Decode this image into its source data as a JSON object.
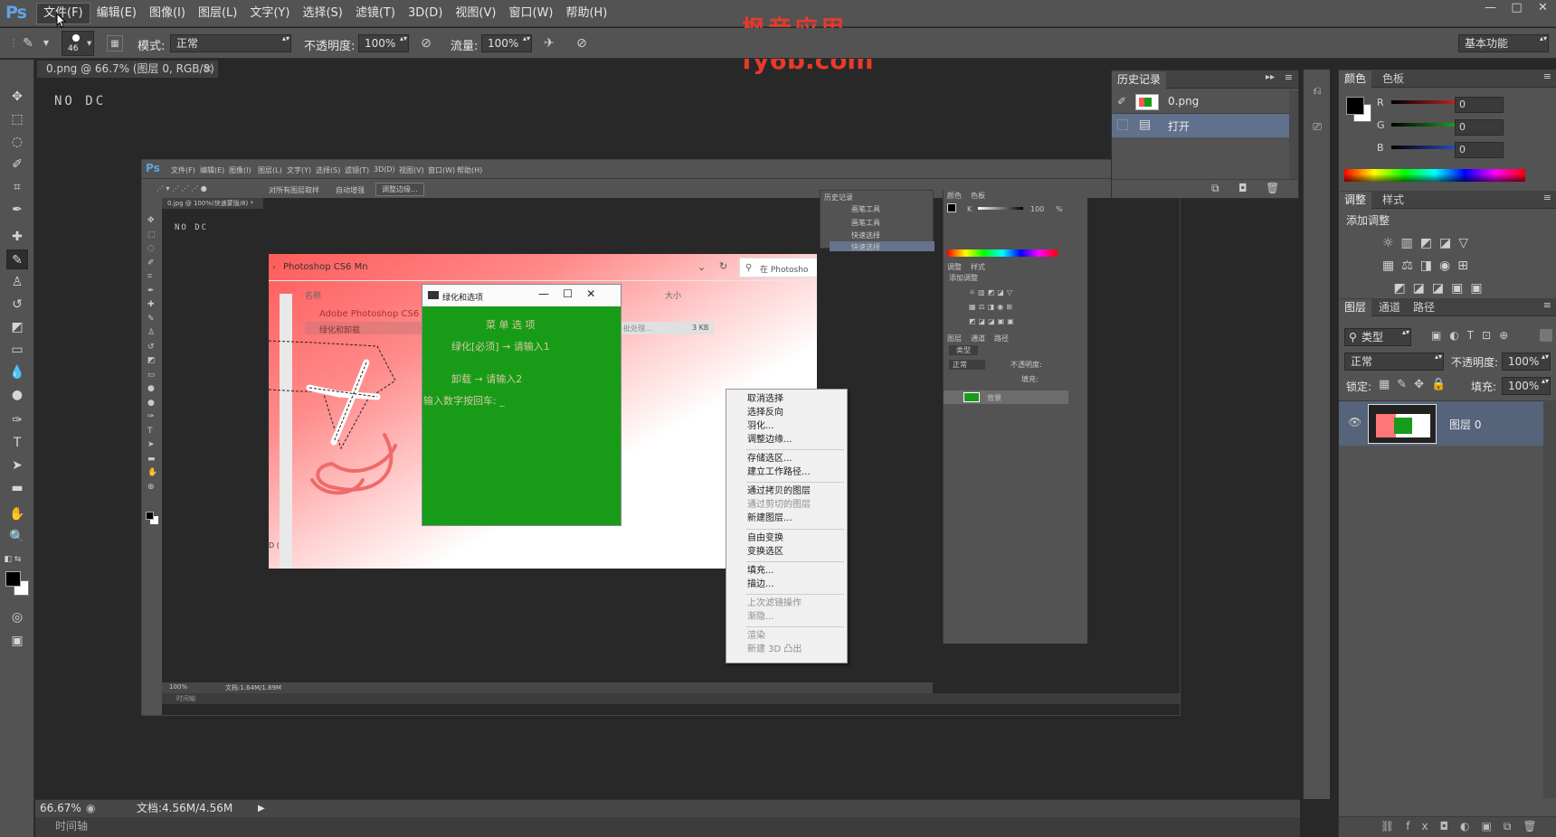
{
  "app": {
    "logo": "Ps",
    "menus": [
      "文件(F)",
      "编辑(E)",
      "图像(I)",
      "图层(L)",
      "文字(Y)",
      "选择(S)",
      "滤镜(T)",
      "3D(D)",
      "视图(V)",
      "窗口(W)",
      "帮助(H)"
    ],
    "window_controls": [
      "—",
      "□",
      "✕"
    ]
  },
  "watermark": {
    "line1": "枫音应用",
    "line2": "fy6b.com"
  },
  "options": {
    "brush_size": "46",
    "mode_label": "模式:",
    "mode_value": "正常",
    "opacity_label": "不透明度:",
    "opacity_value": "100%",
    "flow_label": "流量:",
    "flow_value": "100%",
    "workspace": "基本功能"
  },
  "document": {
    "tab_title": "0.png @ 66.7% (图层 0, RGB/8)",
    "tab_close": "×",
    "canvas_text": "NO DC"
  },
  "status": {
    "zoom": "66.67%",
    "doc_info": "文档:4.56M/4.56M",
    "timeline": "时间轴"
  },
  "history": {
    "tab": "历史记录",
    "snapshot": "0.png",
    "items": [
      "打开"
    ]
  },
  "color_panel": {
    "tabs": [
      "颜色",
      "色板"
    ],
    "channels": [
      {
        "label": "R",
        "value": "0",
        "color": "#d82727"
      },
      {
        "label": "G",
        "value": "0",
        "color": "#22b02a"
      },
      {
        "label": "B",
        "value": "0",
        "color": "#2a55d6"
      }
    ]
  },
  "adjustments": {
    "tabs": [
      "调整",
      "样式"
    ],
    "title": "添加调整"
  },
  "layers": {
    "tabs": [
      "图层",
      "通道",
      "路径"
    ],
    "filter": "类型",
    "blend": "正常",
    "opacity_label": "不透明度:",
    "opacity": "100%",
    "lock_label": "锁定:",
    "fill_label": "填充:",
    "fill": "100%",
    "layer_name": "图层 0"
  },
  "inner": {
    "menus": [
      "文件(F)",
      "编辑(E)",
      "图像(I)",
      "图层(L)",
      "文字(Y)",
      "选择(S)",
      "滤镜(T)",
      "3D(D)",
      "视图(V)",
      "窗口(W)",
      "帮助(H)"
    ],
    "options": [
      "对所有图层取样",
      "自动增强",
      "调整边缘..."
    ],
    "tab": "0.jpg @ 100%(快速蒙版/8) *",
    "canvas_text": "NO DC",
    "history_tab": "历史记录",
    "history_items": [
      "画笔工具",
      "画笔工具",
      "快速选择",
      "快速选择"
    ],
    "color_tabs": [
      "颜色",
      "色板"
    ],
    "k_label": "K",
    "k_value": "100",
    "k_unit": "%",
    "adj_tabs": [
      "调整",
      "样式"
    ],
    "adj_title": "添加调整",
    "layer_tabs": [
      "图层",
      "通道",
      "路径"
    ],
    "layer_filter": "类型",
    "layer_blend": "正常",
    "layer_opacity": "不透明度:",
    "layer_fill": "填充:",
    "layer_name": "背景",
    "zoom": "100%",
    "doc": "文档:1.64M/1.89M",
    "timeline": "时间轴",
    "explorer_path": "Photoshop CS6 Mn",
    "explorer_search": "在 Photosho",
    "explorer_col_name": "名称",
    "explorer_col_size": "大小",
    "explorer_rows": [
      {
        "name": "Adobe Photoshop CS6",
        "size": ""
      },
      {
        "name": "绿化和卸载",
        "size": ""
      }
    ],
    "explorer_extra": "批处理...",
    "explorer_extra_size": "3 KB",
    "console_title": "绿化和选项",
    "console_lines": [
      "菜 单 选 项",
      "绿化[必须] → 请输入1",
      "卸载 → 请输入2",
      "输入数字按回车: _"
    ],
    "side_text": "D ("
  },
  "context_menu": {
    "items": [
      {
        "label": "取消选择",
        "disabled": false
      },
      {
        "label": "选择反向",
        "disabled": false
      },
      {
        "label": "羽化...",
        "disabled": false
      },
      {
        "label": "调整边缘...",
        "disabled": false
      },
      {
        "label": "存储选区...",
        "disabled": false
      },
      {
        "label": "建立工作路径...",
        "disabled": false
      },
      {
        "label": "通过拷贝的图层",
        "disabled": false
      },
      {
        "label": "通过剪切的图层",
        "disabled": true
      },
      {
        "label": "新建图层...",
        "disabled": false
      },
      {
        "label": "自由变换",
        "disabled": false
      },
      {
        "label": "变换选区",
        "disabled": false
      },
      {
        "label": "填充...",
        "disabled": false
      },
      {
        "label": "描边...",
        "disabled": false
      },
      {
        "label": "上次滤镜操作",
        "disabled": true
      },
      {
        "label": "渐隐...",
        "disabled": true
      },
      {
        "label": "渲染",
        "disabled": true
      },
      {
        "label": "新建 3D 凸出",
        "disabled": true
      }
    ]
  }
}
